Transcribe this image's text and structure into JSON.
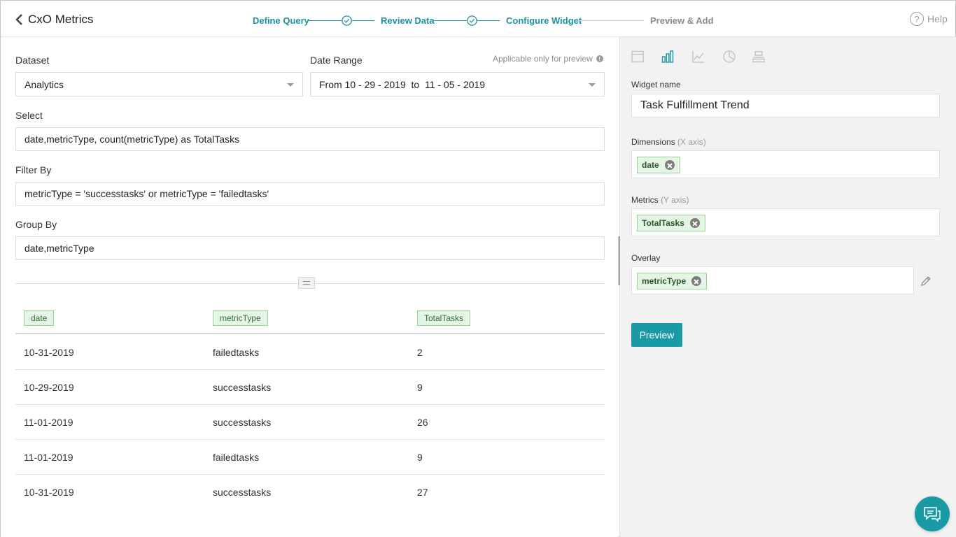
{
  "app": {
    "title": "CxO Metrics"
  },
  "steps": [
    {
      "label": "Define Query",
      "state": "done"
    },
    {
      "label": "Review Data",
      "state": "done"
    },
    {
      "label": "Configure Widget",
      "state": "active"
    },
    {
      "label": "Preview & Add",
      "state": "todo"
    }
  ],
  "help": {
    "label": "Help",
    "glyph": "?"
  },
  "query": {
    "dataset_label": "Dataset",
    "dataset_value": "Analytics",
    "date_range_label": "Date Range",
    "date_range_note": "Applicable only for preview",
    "date_range_value": "From 10 - 29 - 2019  to  11 - 05 - 2019",
    "select_label": "Select",
    "select_value": "date,metricType, count(metricType) as TotalTasks",
    "filter_label": "Filter By",
    "filter_value": "metricType = 'successtasks' or metricType = 'failedtasks'",
    "group_label": "Group By",
    "group_value": "date,metricType"
  },
  "table": {
    "columns": [
      "date",
      "metricType",
      "TotalTasks"
    ],
    "rows": [
      [
        "10-31-2019",
        "failedtasks",
        "2"
      ],
      [
        "10-29-2019",
        "successtasks",
        "9"
      ],
      [
        "11-01-2019",
        "successtasks",
        "26"
      ],
      [
        "11-01-2019",
        "failedtasks",
        "9"
      ],
      [
        "10-31-2019",
        "successtasks",
        "27"
      ]
    ]
  },
  "widget": {
    "visualizations": [
      "table-icon",
      "bar-chart-icon",
      "line-chart-icon",
      "pie-chart-icon",
      "stacked-icon"
    ],
    "active_visualization": "bar-chart-icon",
    "name_label": "Widget name",
    "name_value": "Task Fulfillment Trend",
    "dimensions_label": "Dimensions",
    "dimensions_hint": "(X axis)",
    "dimensions_tag": "date",
    "metrics_label": "Metrics",
    "metrics_hint": "(Y axis)",
    "metrics_tag": "TotalTasks",
    "overlay_label": "Overlay",
    "overlay_tag": "metricType",
    "preview_label": "Preview"
  },
  "colors": {
    "accent": "#1a93a3",
    "button": "#1a9aa5",
    "chip_bg": "#e5f5e5",
    "chip_border": "#9ad29a",
    "inactive_icon": "#c4c4c4"
  }
}
